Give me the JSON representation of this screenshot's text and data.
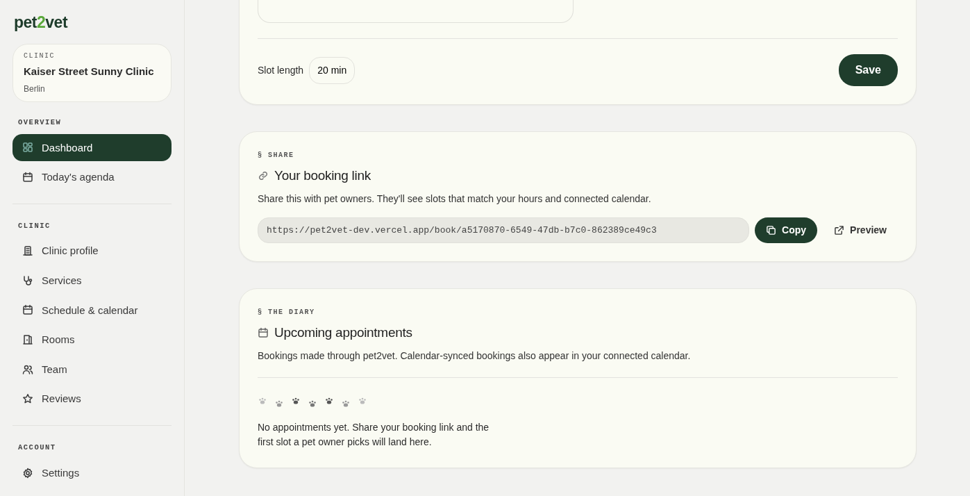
{
  "sidebar": {
    "logo": [
      {
        "text": "pet",
        "accent": false
      },
      {
        "text": "2",
        "accent": true
      },
      {
        "text": "vet",
        "accent": false
      }
    ],
    "clinic_card": {
      "label": "CLINIC",
      "name": "Kaiser Street Sunny Clinic",
      "city": "Berlin"
    },
    "sections": [
      {
        "title": "OVERVIEW",
        "items": [
          {
            "label": "Dashboard",
            "kind": "grid",
            "selected": true
          },
          {
            "label": "Today's agenda",
            "kind": "calendar",
            "selected": false
          }
        ]
      },
      {
        "title": "CLINIC",
        "items": [
          {
            "label": "Clinic profile",
            "kind": "building",
            "selected": false
          },
          {
            "label": "Services",
            "kind": "stethoscope",
            "selected": false
          },
          {
            "label": "Schedule & calendar",
            "kind": "calendar",
            "selected": false
          },
          {
            "label": "Rooms",
            "kind": "door",
            "selected": false
          },
          {
            "label": "Team",
            "kind": "people",
            "selected": false
          },
          {
            "label": "Reviews",
            "kind": "star",
            "selected": false
          }
        ]
      },
      {
        "title": "ACCOUNT",
        "items": [
          {
            "label": "Settings",
            "kind": "gear",
            "selected": false
          }
        ]
      }
    ]
  },
  "hours_card": {
    "slot_label": "Slot length",
    "slot_value": "20 min",
    "save": "Save"
  },
  "share_card": {
    "eyebrow": "§ SHARE",
    "title": "Your booking link",
    "description": "Share this with pet owners. They'll see slots that match your hours and connected calendar.",
    "url": "https://pet2vet-dev.vercel.app/book/a5170870-6549-47db-b7c0-862389ce49c3",
    "copy": "Copy",
    "preview": "Preview"
  },
  "diary_card": {
    "eyebrow": "§ THE DIARY",
    "title": "Upcoming appointments",
    "description": "Bookings made through pet2vet. Calendar-synced bookings also appear in your connected calendar.",
    "empty_lines": [
      "No appointments yet. Share your booking link and the",
      "first slot a pet owner picks will land here."
    ]
  }
}
